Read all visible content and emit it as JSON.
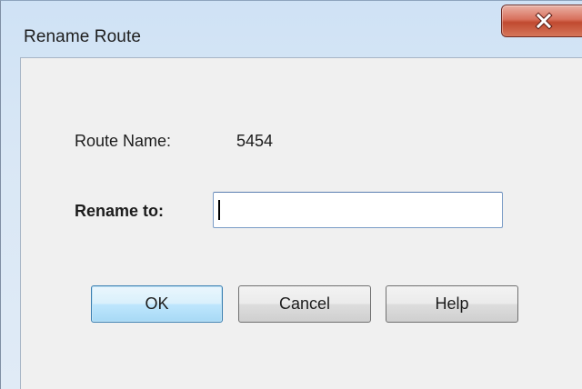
{
  "window": {
    "title": "Rename Route"
  },
  "form": {
    "route_name_label": "Route Name:",
    "route_name_value": "5454",
    "rename_label": "Rename to:",
    "rename_value": ""
  },
  "buttons": {
    "ok_label": "OK",
    "cancel_label": "Cancel",
    "help_label": "Help"
  },
  "icons": {
    "close": "close-icon"
  },
  "colors": {
    "close_button": "#c9553c",
    "default_button_border": "#3c7fb1",
    "client_background": "#f0f0f0"
  }
}
